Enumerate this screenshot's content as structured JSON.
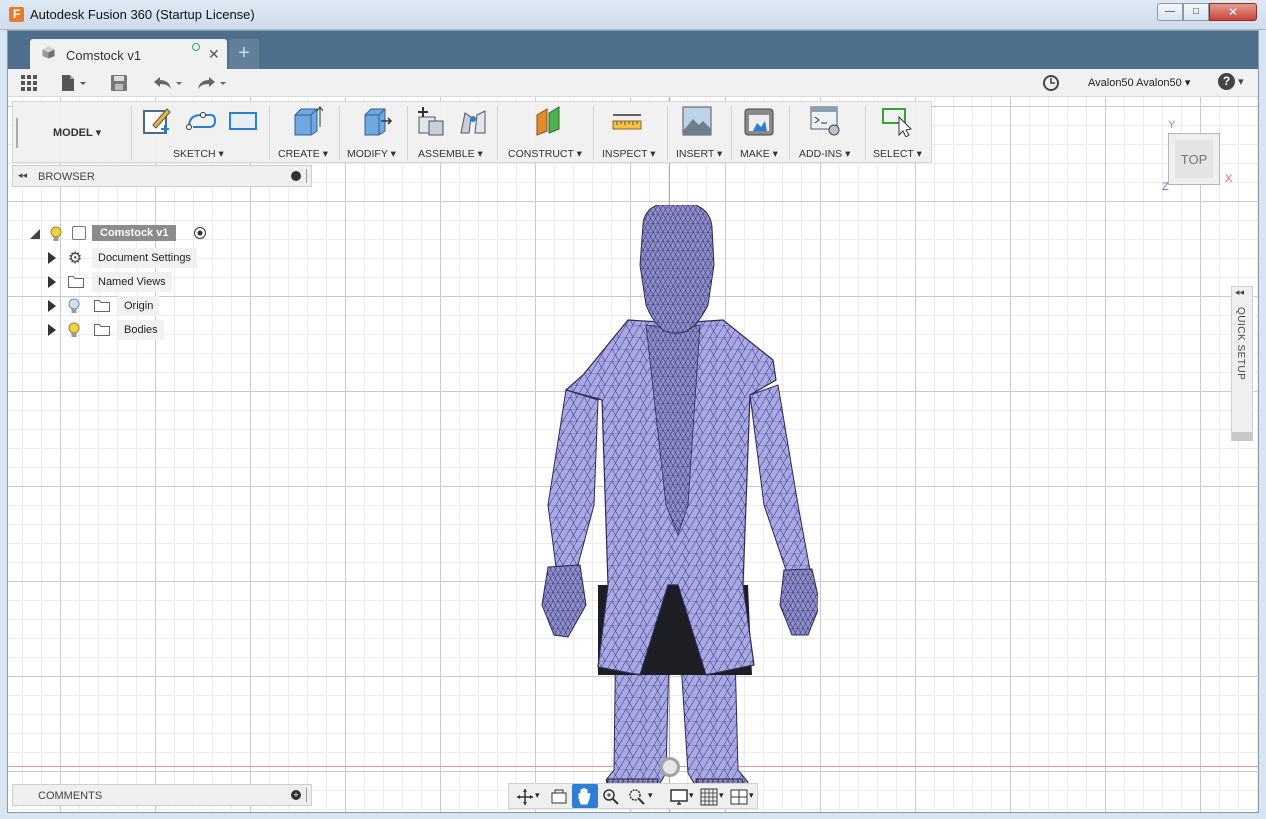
{
  "window": {
    "title": "Autodesk Fusion 360 (Startup License)",
    "logo_letter": "F",
    "min_glyph": "—",
    "max_glyph": "□",
    "close_glyph": "✕"
  },
  "tab": {
    "label": "Comstock v1",
    "close_glyph": "✕",
    "new_tab_glyph": "+"
  },
  "quickbar": {
    "user": "Avalon50 Avalon50",
    "dropdown_glyph": "▾",
    "help_glyph": "?"
  },
  "ribbon": {
    "workspace": "MODEL",
    "groups": [
      "SKETCH",
      "CREATE",
      "MODIFY",
      "ASSEMBLE",
      "CONSTRUCT",
      "INSPECT",
      "INSERT",
      "MAKE",
      "ADD-INS",
      "SELECT"
    ]
  },
  "browser": {
    "title": "BROWSER",
    "collapse_glyph": "◂◂",
    "root_label": "Comstock v1",
    "items": [
      {
        "label": "Document Settings",
        "icon": "gear-icon"
      },
      {
        "label": "Named Views",
        "icon": "folder-icon"
      },
      {
        "label": "Origin",
        "icon": "folder-icon"
      },
      {
        "label": "Bodies",
        "icon": "folder-icon"
      }
    ]
  },
  "viewcube": {
    "face": "TOP",
    "axis_y": "Y",
    "axis_x": "X",
    "axis_z": "Z"
  },
  "quick_setup": {
    "label": "QUICK SETUP",
    "expand_glyph": "◂◂"
  },
  "comments": {
    "label": "COMMENTS"
  },
  "colors": {
    "accent_tabbar": "#4e6f8c",
    "mesh_fill": "#a7a7e6",
    "mesh_line": "#3c3c6e"
  }
}
